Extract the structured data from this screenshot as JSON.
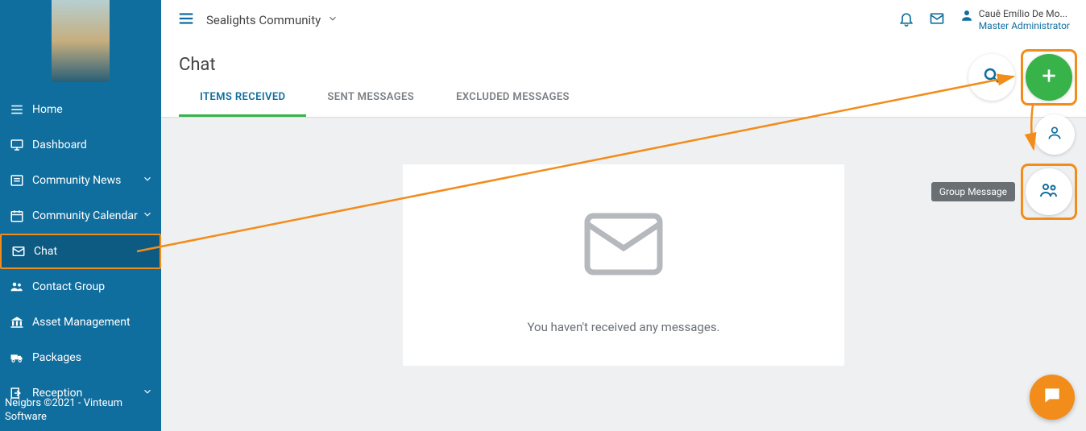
{
  "header": {
    "community_name": "Sealights Community",
    "user_name": "Cauê Emílio De Mo...",
    "user_role": "Master Administrator"
  },
  "page": {
    "title": "Chat"
  },
  "tabs": [
    {
      "label": "ITEMS RECEIVED",
      "active": true
    },
    {
      "label": "SENT MESSAGES",
      "active": false
    },
    {
      "label": "EXCLUDED MESSAGES",
      "active": false
    }
  ],
  "empty_state": {
    "message": "You haven't received any messages."
  },
  "fab": {
    "tooltip_group": "Group Message"
  },
  "sidebar": {
    "items": [
      {
        "label": "Home",
        "icon": "menu"
      },
      {
        "label": "Dashboard",
        "icon": "monitor"
      },
      {
        "label": "Community News",
        "icon": "news",
        "expandable": true
      },
      {
        "label": "Community Calendar",
        "icon": "calendar",
        "expandable": true
      },
      {
        "label": "Chat",
        "icon": "mail",
        "active": true
      },
      {
        "label": "Contact Group",
        "icon": "group"
      },
      {
        "label": "Asset Management",
        "icon": "bank"
      },
      {
        "label": "Packages",
        "icon": "truck"
      },
      {
        "label": "Reception",
        "icon": "login",
        "expandable": true
      }
    ],
    "footer_line1": "Neigbrs ©2021 - Vinteum",
    "footer_line2": "Software"
  }
}
